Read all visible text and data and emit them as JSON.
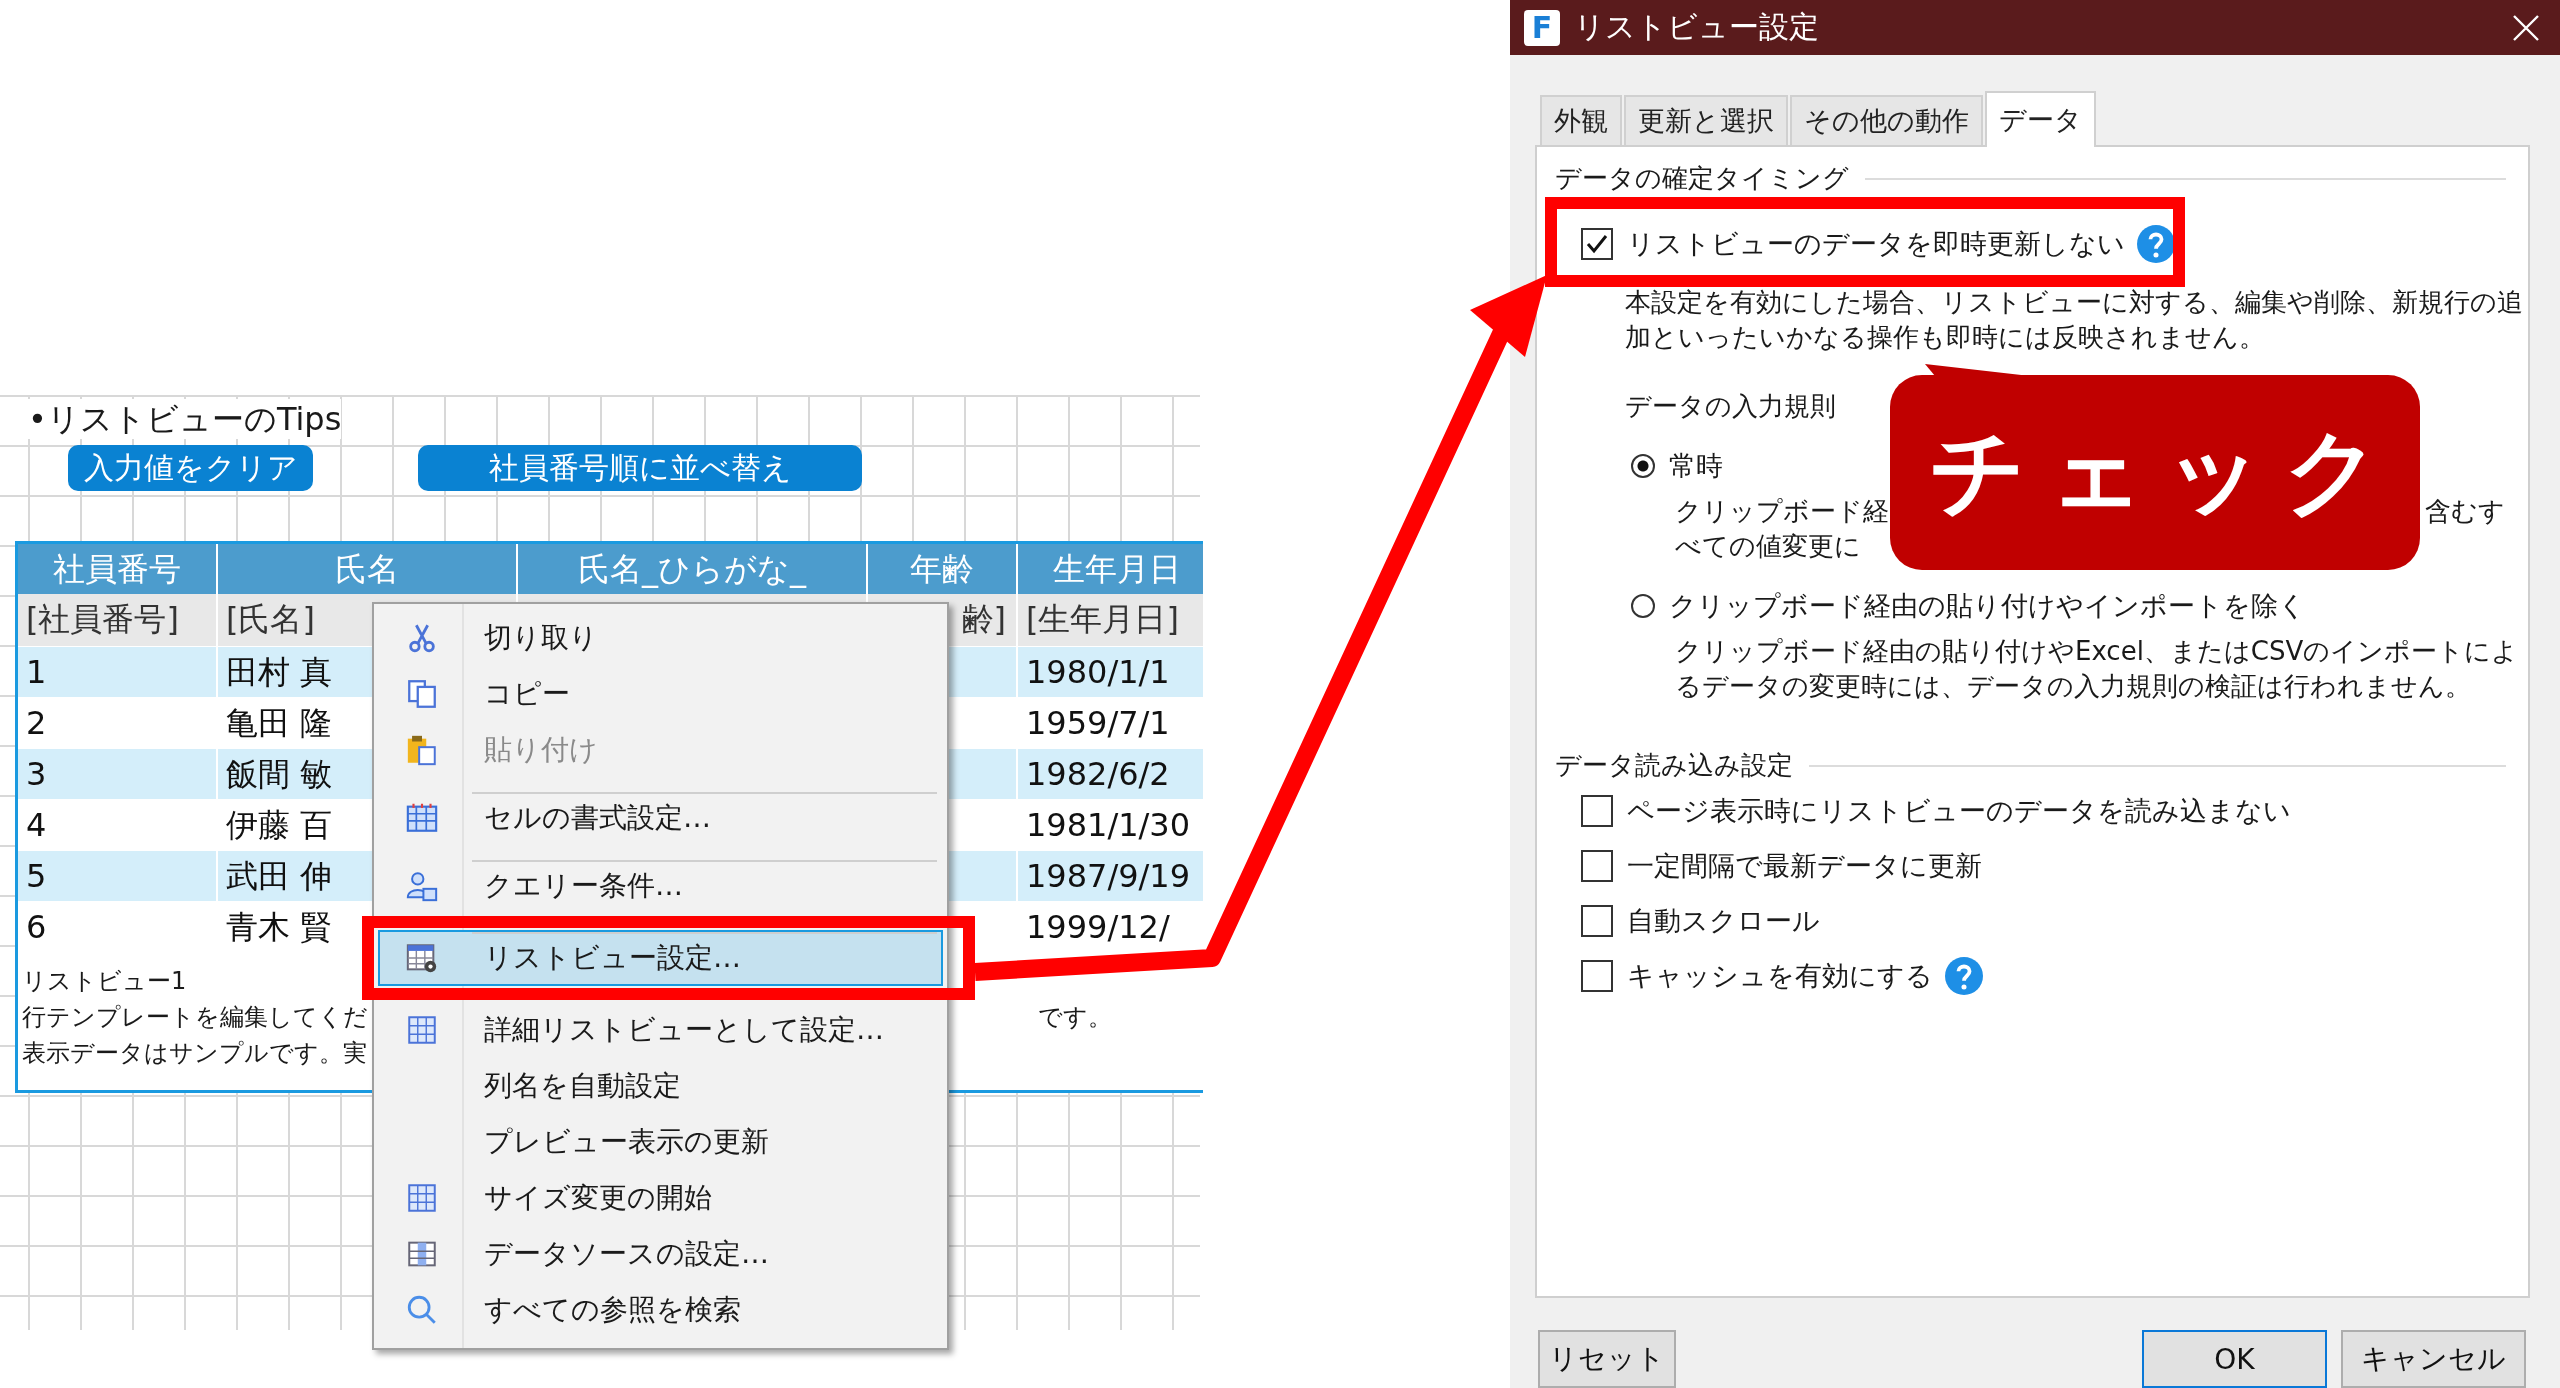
{
  "sheet": {
    "tips_title": "•リストビューのTips",
    "buttons": [
      "入力値をクリア",
      "社員番号順に並べ替え"
    ],
    "listview": {
      "columns": [
        "社員番号",
        "氏名",
        "氏名_ひらがな_",
        "年齢",
        "生年月日"
      ],
      "template_row": {
        "id": "[社員番号]",
        "name": "[氏名]",
        "age": "齢]",
        "birth": "[生年月日]"
      },
      "rows": [
        {
          "id": "1",
          "name": "田村 真",
          "birth": "1980/1/1",
          "shaded": true
        },
        {
          "id": "2",
          "name": "亀田 隆",
          "birth": "1959/7/1",
          "shaded": false
        },
        {
          "id": "3",
          "name": "飯間 敏",
          "birth": "1982/6/2",
          "shaded": true
        },
        {
          "id": "4",
          "name": "伊藤 百",
          "birth": "1981/1/30",
          "shaded": false
        },
        {
          "id": "5",
          "name": "武田 伸",
          "birth": "1987/9/19",
          "shaded": true
        },
        {
          "id": "6",
          "name": "青木 賢",
          "birth": "1999/12/",
          "shaded": false
        }
      ],
      "caption": "リストビュー1",
      "notes": [
        "行テンプレートを編集してくだ",
        "表示データはサンプルです。実"
      ],
      "note_tail": "です。"
    }
  },
  "context_menu": {
    "items": [
      {
        "label": "切り取り",
        "disabled": false,
        "selected": false,
        "separator_before": false
      },
      {
        "label": "コピー",
        "disabled": false,
        "selected": false,
        "separator_before": false
      },
      {
        "label": "貼り付け",
        "disabled": true,
        "selected": false,
        "separator_before": false
      },
      {
        "label": "セルの書式設定…",
        "disabled": false,
        "selected": false,
        "separator_before": true
      },
      {
        "label": "クエリー条件…",
        "disabled": false,
        "selected": false,
        "separator_before": true
      },
      {
        "label": "リストビュー設定…",
        "disabled": false,
        "selected": true,
        "separator_before": true
      },
      {
        "label": "詳細リストビューとして設定…",
        "disabled": false,
        "selected": false,
        "separator_before": false
      },
      {
        "label": "列名を自動設定",
        "disabled": false,
        "selected": false,
        "separator_before": false
      },
      {
        "label": "プレビュー表示の更新",
        "disabled": false,
        "selected": false,
        "separator_before": false
      },
      {
        "label": "サイズ変更の開始",
        "disabled": false,
        "selected": false,
        "separator_before": false
      },
      {
        "label": "データソースの設定…",
        "disabled": false,
        "selected": false,
        "separator_before": false
      },
      {
        "label": "すべての参照を検索",
        "disabled": false,
        "selected": false,
        "separator_before": false
      }
    ]
  },
  "dialog": {
    "app_icon_letter": "F",
    "title": "リストビュー設定",
    "tabs": [
      {
        "label": "外観",
        "selected": false
      },
      {
        "label": "更新と選択",
        "selected": false
      },
      {
        "label": "その他の動作",
        "selected": false
      },
      {
        "label": "データ",
        "selected": true
      }
    ],
    "commit_group": {
      "heading": "データの確定タイミング",
      "checkbox": {
        "label": "リストビューのデータを即時更新しない",
        "checked": true,
        "help": true
      },
      "description": "本設定を有効にした場合、リストビューに対する、編集や削除、新規行の追加といったいかなる操作も即時には反映されません。",
      "rule_label": "データの入力規則",
      "radios": [
        {
          "label": "常時",
          "selected": true,
          "description_parts": [
            "クリップボード経",
            "含むす",
            "べての値変更に"
          ]
        },
        {
          "label": "クリップボード経由の貼り付けやインポートを除く",
          "selected": false,
          "description_parts": [
            "クリップボード経由の貼り付けやExcel、またはCSVのインポートによるデータの変更時には、データの入力規則の検証は行われません。"
          ]
        }
      ]
    },
    "load_group": {
      "heading": "データ読み込み設定",
      "checkboxes": [
        {
          "label": "ページ表示時にリストビューのデータを読み込まない",
          "checked": false,
          "help": false
        },
        {
          "label": "一定間隔で最新データに更新",
          "checked": false,
          "help": false
        },
        {
          "label": "自動スクロール",
          "checked": false,
          "help": false
        },
        {
          "label": "キャッシュを有効にする",
          "checked": false,
          "help": true
        }
      ]
    },
    "buttons": [
      {
        "label": "リセット",
        "default": false
      },
      {
        "label": "OK",
        "default": true
      },
      {
        "label": "キャンセル",
        "default": false
      }
    ]
  },
  "callout": {
    "text": "チェック"
  }
}
